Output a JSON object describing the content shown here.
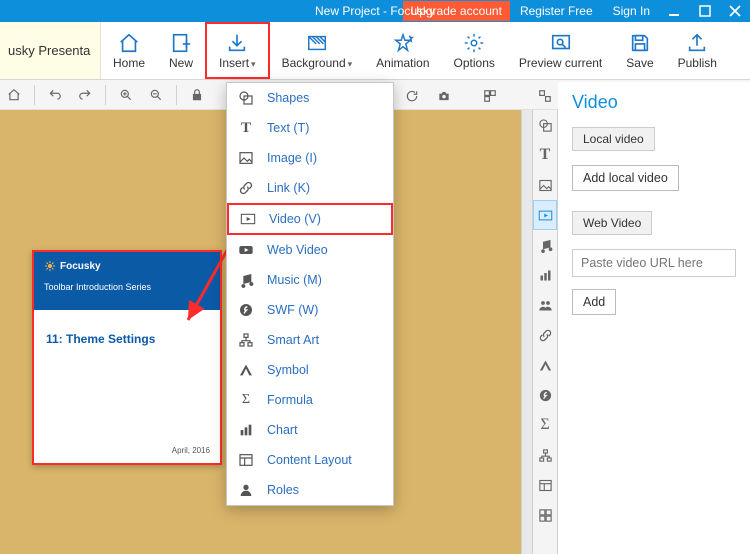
{
  "titlebar": {
    "title": "New Project - Focusky",
    "upgrade": "Upgrade account",
    "register": "Register Free",
    "signin": "Sign In"
  },
  "file_tab": "usky Presenta",
  "ribbon": {
    "home": "Home",
    "new": "New",
    "insert": "Insert",
    "background": "Background",
    "animation": "Animation",
    "options": "Options",
    "preview": "Preview current",
    "save": "Save",
    "publish": "Publish"
  },
  "menu": {
    "shapes": "Shapes",
    "text": "Text (T)",
    "image": "Image (I)",
    "link": "Link (K)",
    "video": "Video (V)",
    "web_video": "Web Video",
    "music": "Music (M)",
    "swf": "SWF (W)",
    "smart_art": "Smart Art",
    "symbol": "Symbol",
    "formula": "Formula",
    "chart": "Chart",
    "content_layout": "Content Layout",
    "roles": "Roles"
  },
  "slide": {
    "brand": "Focusky",
    "series": "Toolbar Introduction Series",
    "heading": "11: Theme Settings",
    "date": "April, 2016"
  },
  "panel": {
    "title": "Video",
    "local_tab": "Local video",
    "add_local": "Add local video",
    "web_tab": "Web Video",
    "url_placeholder": "Paste video URL here",
    "add": "Add"
  }
}
